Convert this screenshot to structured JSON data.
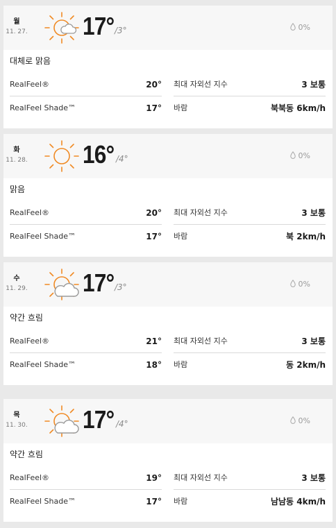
{
  "labels": {
    "realfeel": "RealFeel®",
    "realfeel_shade": "RealFeel Shade™",
    "uv": "최대 자외선 지수",
    "wind": "바람"
  },
  "days": [
    {
      "day": "월",
      "date": "11. 27.",
      "icon": "sun-with-small-cloud-icon",
      "high": "17°",
      "low": "/3°",
      "precip": "0%",
      "phrase": "대체로 맑음",
      "realfeel": "20°",
      "realfeel_shade": "17°",
      "uv": "3 보통",
      "wind": "북북동 6km/h"
    },
    {
      "day": "화",
      "date": "11. 28.",
      "icon": "sun-icon",
      "high": "16°",
      "low": "/4°",
      "precip": "0%",
      "phrase": "맑음",
      "realfeel": "20°",
      "realfeel_shade": "17°",
      "uv": "3 보통",
      "wind": "북 2km/h"
    },
    {
      "day": "수",
      "date": "11. 29.",
      "icon": "partly-cloudy-icon",
      "high": "17°",
      "low": "/3°",
      "precip": "0%",
      "phrase": "약간 흐림",
      "realfeel": "21°",
      "realfeel_shade": "18°",
      "uv": "3 보통",
      "wind": "동 2km/h"
    },
    {
      "day": "목",
      "date": "11. 30.",
      "icon": "partly-cloudy-icon",
      "high": "17°",
      "low": "/4°",
      "precip": "0%",
      "phrase": "약간 흐림",
      "realfeel": "19°",
      "realfeel_shade": "17°",
      "uv": "3 보통",
      "wind": "남남동 4km/h"
    }
  ],
  "colors": {
    "sun": "#f08a24",
    "cloud_stroke": "#9a9a9a",
    "page_bg": "#e9e9e9",
    "header_bg": "#f7f7f7"
  }
}
